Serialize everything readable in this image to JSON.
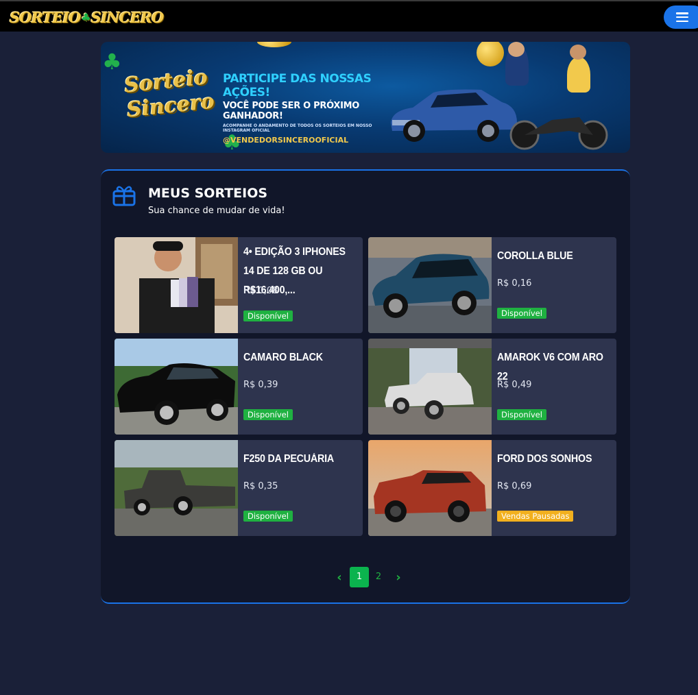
{
  "header": {
    "logo_text_left": "SORTEIO",
    "logo_text_right": "SINCERO",
    "menu_icon": "hamburger-menu-icon"
  },
  "banner": {
    "logo_line1": "Sorteio",
    "logo_line2": "Sincero",
    "headline": "PARTICIPE DAS NOSSAS AÇÕES!",
    "subheadline": "VOCÊ PODE SER O PRÓXIMO GANHADOR!",
    "small_text": "ACOMPANHE O ANDAMENTO DE TODOS OS SORTEIOS EM NOSSO INSTAGRAM OFICIAL",
    "instagram": "@VENDEDORSINCEROOFICIAL"
  },
  "section": {
    "icon": "gift-icon",
    "title": "MEUS SORTEIOS",
    "subtitle": "Sua chance de mudar de vida!"
  },
  "raffles": [
    {
      "title": "4• EDIÇÃO 3 IPHONES 14 DE 128 GB OU R$16.400,...",
      "price": "R$ 0,08",
      "status": "Disponível",
      "status_type": "ok"
    },
    {
      "title": "COROLLA BLUE",
      "price": "R$ 0,16",
      "status": "Disponível",
      "status_type": "ok"
    },
    {
      "title": "CAMARO BLACK",
      "price": "R$ 0,39",
      "status": "Disponível",
      "status_type": "ok"
    },
    {
      "title": "AMAROK V6 COM ARO 22",
      "price": "R$ 0,49",
      "status": "Disponível",
      "status_type": "ok"
    },
    {
      "title": "F250 DA PECUÁRIA",
      "price": "R$ 0,35",
      "status": "Disponível",
      "status_type": "ok"
    },
    {
      "title": "FORD DOS SONHOS",
      "price": "R$ 0,69",
      "status": "Vendas Pausadas",
      "status_type": "paused"
    }
  ],
  "pagination": {
    "prev_icon": "chevron-left-icon",
    "next_icon": "chevron-right-icon",
    "pages": [
      "1",
      "2"
    ],
    "current": "1"
  },
  "colors": {
    "background": "#1a2038",
    "card": "#111629",
    "item": "#2e344e",
    "accent_blue": "#1a73e8",
    "available_green": "#1fb141",
    "paused_yellow": "#f2b01e",
    "logo_gold": "#f2c94c"
  }
}
